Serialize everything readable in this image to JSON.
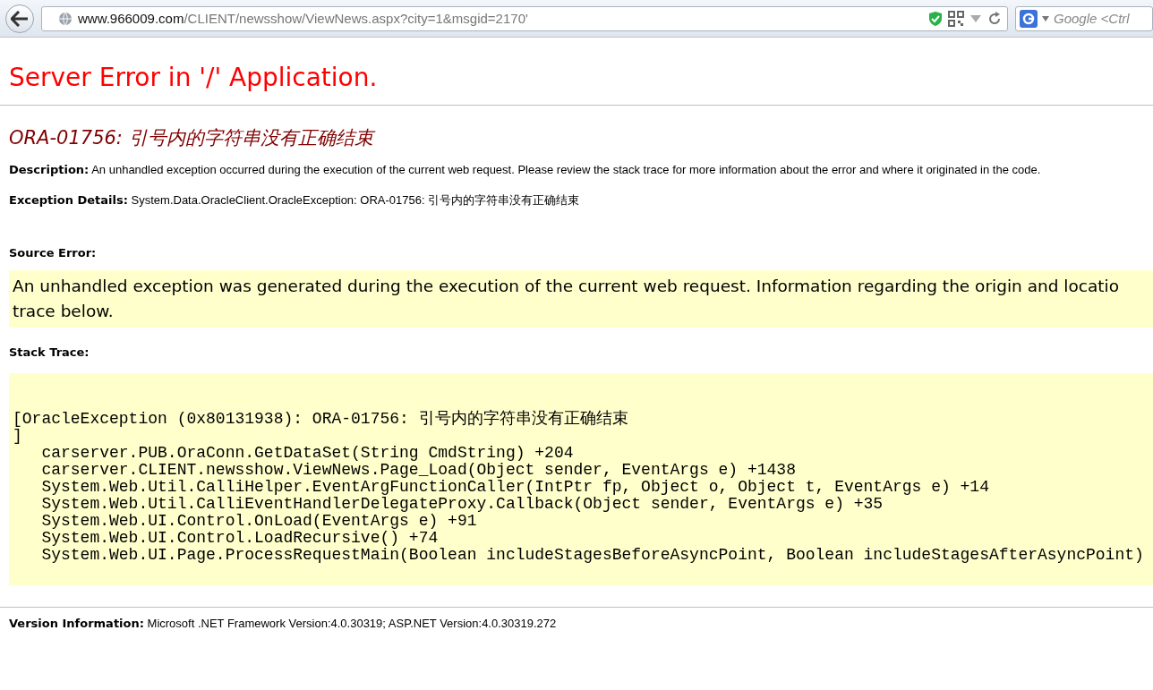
{
  "browser": {
    "url_host": "www.966009.com",
    "url_path": "/CLIENT/newsshow/ViewNews.aspx?city=1&msgid=2170'",
    "search_placeholder": "Google <Ctrl"
  },
  "page": {
    "title": "Server Error in '/' Application.",
    "error_heading": "ORA-01756: 引号内的字符串没有正确结束",
    "description": {
      "label": "Description:",
      "text": "An unhandled exception occurred during the execution of the current web request. Please review the stack trace for more information about the error and where it originated in the code."
    },
    "exception_details": {
      "label": "Exception Details:",
      "text": "System.Data.OracleClient.OracleException: ORA-01756: 引号内的字符串没有正确结束"
    },
    "source_error": {
      "label": "Source Error:",
      "lines": [
        "An unhandled exception was generated during the execution of the current web request. Information regarding the origin and locatio",
        "trace below."
      ]
    },
    "stack_trace": {
      "label": "Stack Trace:",
      "lines": [
        "[OracleException (0x80131938): ORA-01756: 引号内的字符串没有正确结束",
        "]",
        "   carserver.PUB.OraConn.GetDataSet(String CmdString) +204",
        "   carserver.CLIENT.newsshow.ViewNews.Page_Load(Object sender, EventArgs e) +1438",
        "   System.Web.Util.CalliHelper.EventArgFunctionCaller(IntPtr fp, Object o, Object t, EventArgs e) +14",
        "   System.Web.Util.CalliEventHandlerDelegateProxy.Callback(Object sender, EventArgs e) +35",
        "   System.Web.UI.Control.OnLoad(EventArgs e) +91",
        "   System.Web.UI.Control.LoadRecursive() +74",
        "   System.Web.UI.Page.ProcessRequestMain(Boolean includeStagesBeforeAsyncPoint, Boolean includeStagesAfterAsyncPoint)"
      ]
    },
    "version": {
      "label": "Version Information:",
      "text": "Microsoft .NET Framework Version:4.0.30319; ASP.NET Version:4.0.30319.272"
    }
  }
}
